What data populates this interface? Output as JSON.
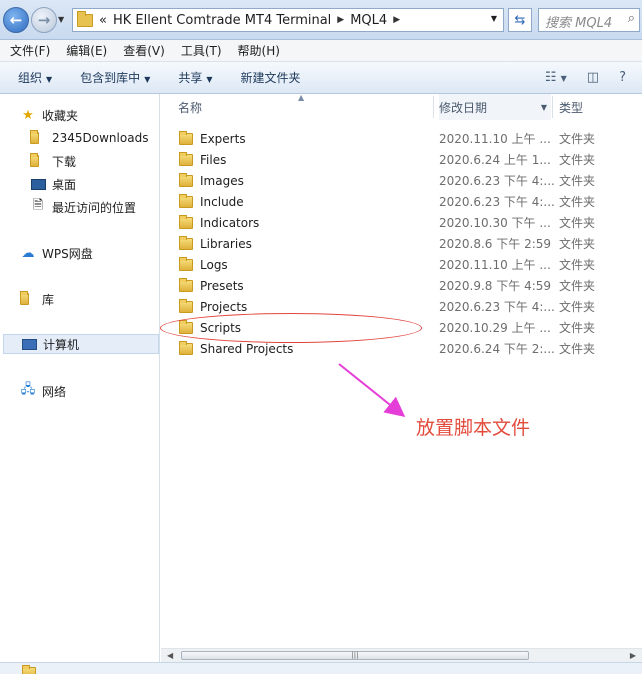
{
  "address": {
    "overflow": "«",
    "crumbs": [
      "HK Ellent Comtrade MT4 Terminal",
      "MQL4"
    ],
    "search_placeholder": "搜索 MQL4"
  },
  "menu": [
    "文件(F)",
    "编辑(E)",
    "查看(V)",
    "工具(T)",
    "帮助(H)"
  ],
  "toolbar": {
    "organize": "组织",
    "include_library": "包含到库中",
    "share": "共享",
    "new_folder": "新建文件夹"
  },
  "nav": {
    "favorites": "收藏夹",
    "fav_items": [
      "2345Downloads",
      "下载",
      "桌面",
      "最近访问的位置"
    ],
    "wps": "WPS网盘",
    "library": "库",
    "computer": "计算机",
    "network": "网络"
  },
  "columns": {
    "name": "名称",
    "date": "修改日期",
    "type": "类型"
  },
  "files": [
    {
      "name": "Experts",
      "date": "2020.11.10 上午 ...",
      "type": "文件夹"
    },
    {
      "name": "Files",
      "date": "2020.6.24 上午 1...",
      "type": "文件夹"
    },
    {
      "name": "Images",
      "date": "2020.6.23 下午 4:...",
      "type": "文件夹"
    },
    {
      "name": "Include",
      "date": "2020.6.23 下午 4:...",
      "type": "文件夹"
    },
    {
      "name": "Indicators",
      "date": "2020.10.30 下午 ...",
      "type": "文件夹"
    },
    {
      "name": "Libraries",
      "date": "2020.8.6 下午 2:59",
      "type": "文件夹"
    },
    {
      "name": "Logs",
      "date": "2020.11.10 上午 ...",
      "type": "文件夹"
    },
    {
      "name": "Presets",
      "date": "2020.9.8 下午 4:59",
      "type": "文件夹"
    },
    {
      "name": "Projects",
      "date": "2020.6.23 下午 4:...",
      "type": "文件夹"
    },
    {
      "name": "Scripts",
      "date": "2020.10.29 上午 ...",
      "type": "文件夹"
    },
    {
      "name": "Shared Projects",
      "date": "2020.6.24 下午 2:...",
      "type": "文件夹"
    }
  ],
  "annotation": "放置脚本文件",
  "annotation_color": "#e24b3c"
}
